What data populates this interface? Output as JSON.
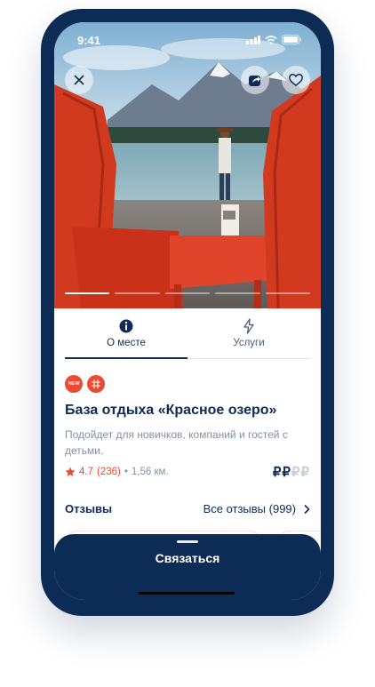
{
  "status_bar": {
    "time": "9:41"
  },
  "gallery": {
    "slide_count": 5,
    "active_slide": 1
  },
  "tabs": [
    {
      "label": "О месте",
      "icon": "info-icon",
      "active": true
    },
    {
      "label": "Услуги",
      "icon": "lightning-icon",
      "active": false
    }
  ],
  "badges": [
    {
      "text": "NEW",
      "icon": "new-badge-icon"
    },
    {
      "text": "",
      "icon": "grid-badge-icon"
    }
  ],
  "place": {
    "title": "База отдыха «Красное озеро»",
    "description": "Подойдет для новичков, компаний и гостей с детьми.",
    "rating": "4.7",
    "reviews_count": "(236)",
    "separator": "•",
    "distance": "1,56 км.",
    "price_active": "₽₽",
    "price_inactive": "₽₽",
    "price_level": 2,
    "price_max": 4
  },
  "reviews": {
    "label": "Отзывы",
    "all_link": "Все отзывы (999)"
  },
  "cta": {
    "label": "Связаться"
  },
  "colors": {
    "primary": "#0d2c55",
    "accent": "#ee4a2f",
    "muted": "#8390a3"
  }
}
